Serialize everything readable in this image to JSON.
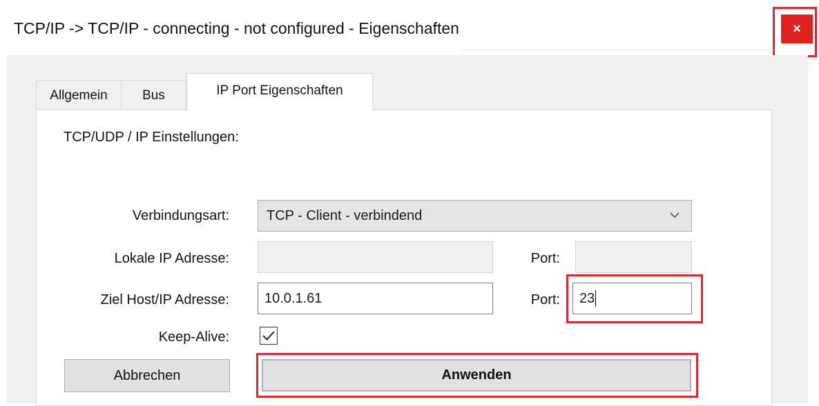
{
  "window": {
    "title": "TCP/IP -> TCP/IP - connecting - not configured - Eigenschaften",
    "close_label": "×"
  },
  "tabs": [
    {
      "label": "Allgemein",
      "selected": false
    },
    {
      "label": "Bus",
      "selected": false
    },
    {
      "label": "IP Port Eigenschaften",
      "selected": true
    }
  ],
  "section": {
    "title": "TCP/UDP / IP Einstellungen:"
  },
  "form": {
    "connection_type_label": "Verbindungsart:",
    "connection_type_value": "TCP - Client - verbindend",
    "local_ip_label": "Lokale IP Adresse:",
    "local_ip_value": "",
    "local_port_label": "Port:",
    "local_port_value": "",
    "target_host_label": "Ziel Host/IP Adresse:",
    "target_host_value": "10.0.1.61",
    "target_port_label": "Port:",
    "target_port_value": "23",
    "keep_alive_label": "Keep-Alive:",
    "keep_alive_checked": true
  },
  "buttons": {
    "cancel_label": "Abbrechen",
    "apply_label": "Anwenden"
  },
  "colors": {
    "highlight": "#e3262e",
    "close_button": "#e12020",
    "dialog_background": "#f0f0f0"
  }
}
